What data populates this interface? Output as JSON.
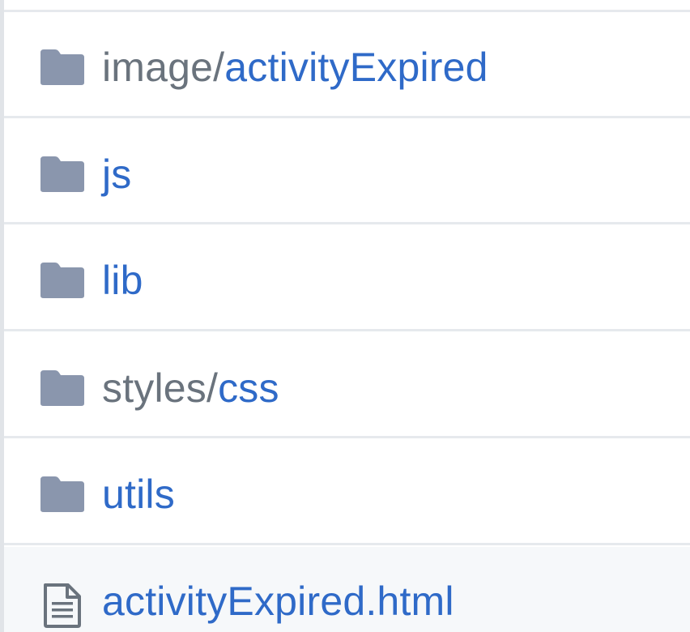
{
  "colors": {
    "folder_icon": "#8a96ad",
    "file_icon": "#6a737d",
    "link": "#2f6ac8",
    "prefix": "#6a737d",
    "border": "#e6e9ed",
    "highlight_bg": "#f6f8fa"
  },
  "rows": [
    {
      "type": "folder",
      "icon": "folder-icon",
      "prefix": "image/",
      "name": "activityExpired"
    },
    {
      "type": "folder",
      "icon": "folder-icon",
      "prefix": "",
      "name": "js"
    },
    {
      "type": "folder",
      "icon": "folder-icon",
      "prefix": "",
      "name": "lib"
    },
    {
      "type": "folder",
      "icon": "folder-icon",
      "prefix": "styles/",
      "name": "css"
    },
    {
      "type": "folder",
      "icon": "folder-icon",
      "prefix": "",
      "name": "utils"
    },
    {
      "type": "file",
      "icon": "file-text-icon",
      "prefix": "",
      "name": "activityExpired.html"
    }
  ]
}
